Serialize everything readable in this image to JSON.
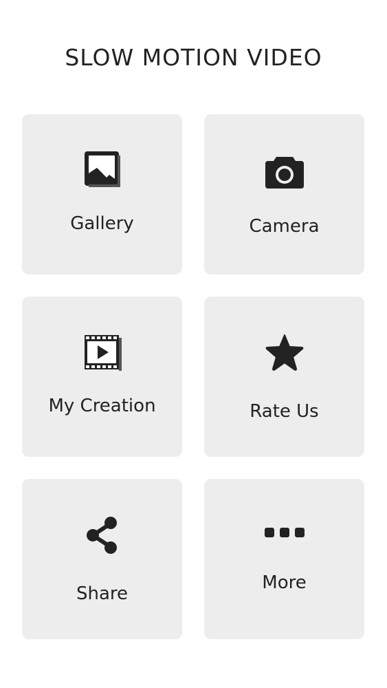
{
  "app": {
    "title": "SLOW MOTION VIDEO"
  },
  "menu": {
    "gallery": {
      "label": "Gallery",
      "icon": "image-icon"
    },
    "camera": {
      "label": "Camera",
      "icon": "camera-icon"
    },
    "my_creation": {
      "label": "My Creation",
      "icon": "film-play-icon"
    },
    "rate_us": {
      "label": "Rate Us",
      "icon": "star-icon"
    },
    "share": {
      "label": "Share",
      "icon": "share-icon"
    },
    "more": {
      "label": "More",
      "icon": "more-dots-icon"
    }
  },
  "colors": {
    "tile_background": "#eeedee",
    "icon": "#222222",
    "text": "#222222"
  }
}
